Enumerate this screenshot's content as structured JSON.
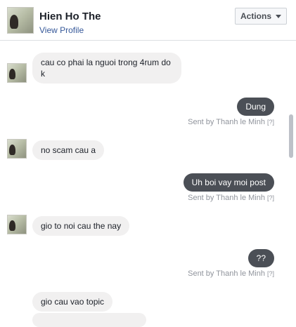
{
  "header": {
    "name": "Hien Ho The",
    "view_profile": "View Profile",
    "actions_label": "Actions"
  },
  "messages": {
    "m1": "cau co phai la nguoi trong 4rum do k",
    "m2": "Dung",
    "m3": "no scam cau a",
    "m4": "Uh boi vay moi post",
    "m5": "gio to noi cau the nay",
    "m6": "??",
    "m7": "gio cau vao topic"
  },
  "sent_by": {
    "text": "Sent by Thanh le Minh",
    "help": "[?]"
  },
  "colors": {
    "outgoing_bubble": "#4b4f56",
    "incoming_bubble": "#f1f0f0",
    "link": "#365899"
  }
}
